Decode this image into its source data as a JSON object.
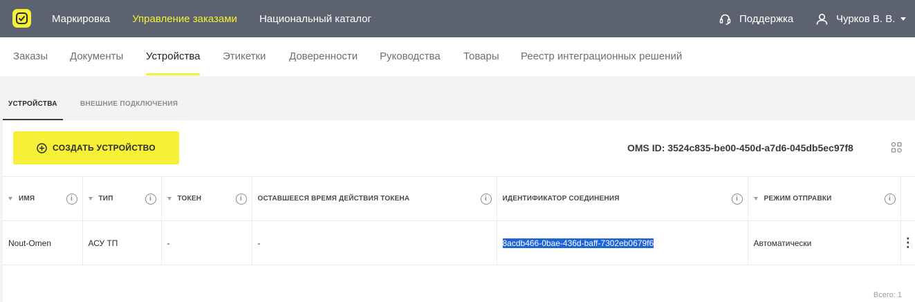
{
  "topbar": {
    "nav": [
      "Маркировка",
      "Управление заказами",
      "Национальный каталог"
    ],
    "active_nav": 1,
    "support": "Поддержка",
    "user": "Чурков В. В."
  },
  "subnav": {
    "tabs": [
      "Заказы",
      "Документы",
      "Устройства",
      "Этикетки",
      "Доверенности",
      "Руководства",
      "Товары",
      "Реестр интеграционных решений"
    ],
    "active": 2
  },
  "inner_tabs": {
    "tabs": [
      "УСТРОЙСТВА",
      "ВНЕШНИЕ ПОДКЛЮЧЕНИЯ"
    ],
    "active": 0
  },
  "toolbar": {
    "create_label": "СОЗДАТЬ УСТРОЙСТВО",
    "oms_id": "OMS ID: 3524c835-be00-450d-a7d6-045db5ec97f8"
  },
  "table": {
    "columns": [
      "ИМЯ",
      "ТИП",
      "ТОКЕН",
      "ОСТАВШЕЕСЯ ВРЕМЯ ДЕЙСТВИЯ ТОКЕНА",
      "ИДЕНТИФИКАТОР СОЕДИНЕНИЯ",
      "РЕЖИМ ОТПРАВКИ"
    ],
    "rows": [
      [
        "Nout-Omen",
        "АСУ ТП",
        "-",
        "-",
        "8acdb466-0bae-436d-baff-7302eb0679f6",
        "Автоматически"
      ]
    ],
    "total": "Всего: 1"
  },
  "colors": {
    "topbar_bg": "#5c6270",
    "accent_yellow": "#f6f036",
    "selection_blue": "#1e64d8"
  }
}
